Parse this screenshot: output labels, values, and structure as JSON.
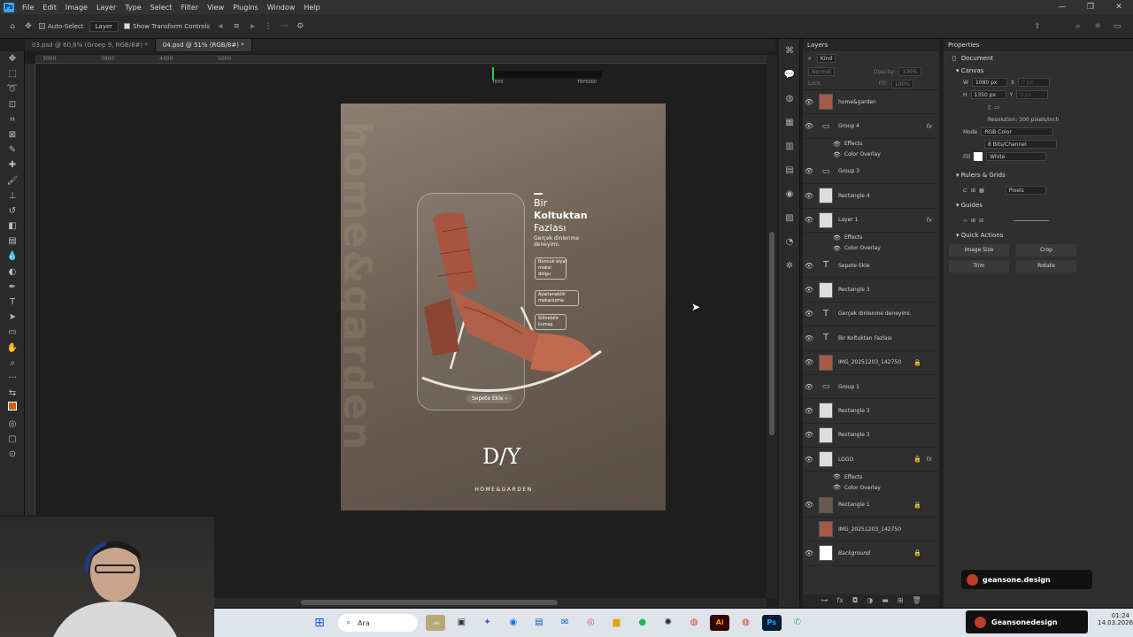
{
  "app": {
    "logo": "Ps"
  },
  "menu": [
    "File",
    "Edit",
    "Image",
    "Layer",
    "Type",
    "Select",
    "Filter",
    "View",
    "Plugins",
    "Window",
    "Help"
  ],
  "options": {
    "auto_select": "Auto-Select",
    "layer_select": "Layer",
    "transform": "Show Transform Controls"
  },
  "tabs": [
    {
      "label": "03.psd @ 60,6% (Groep 9, RGB/8#) *"
    },
    {
      "label": "04.psd @ 51% (RGB/8#) *"
    }
  ],
  "ruler_labels": [
    "3000",
    "3800",
    "4400",
    "5000"
  ],
  "info": {
    "left": "TRY0",
    "right": "TRY5000"
  },
  "poster": {
    "watermark": "home&garden",
    "title_line1": "Bir",
    "title_line2": "Koltuktan",
    "title_line3": "Fazlası",
    "subtitle1": "Gerçek dinlenme",
    "subtitle2": "deneyimi.",
    "feature1": "Boncuk elyaf\nmaksi\ndolgu",
    "feature2": "Ayarlanabilir\nmekanizma",
    "feature3": "Silinebilir\nkumaş",
    "cta": "Sepete Ekle",
    "brand_mark": "D/Y",
    "brand_text": "HOME&GARDEN"
  },
  "layers": {
    "tab": "Layers",
    "filter": "Kind",
    "blend": "Normal",
    "opacity_label": "Opacity:",
    "opacity": "100%",
    "lock_label": "Lock:",
    "fill_label": "Fill:",
    "fill": "100%",
    "rows": [
      {
        "name": "home&garden",
        "type": "img",
        "fx": ""
      },
      {
        "name": "Group 4",
        "type": "folder",
        "fx": "fx"
      },
      {
        "name": "Effects",
        "type": "sub"
      },
      {
        "name": "Color Overlay",
        "type": "sub"
      },
      {
        "name": "Group 3",
        "type": "folder",
        "fx": ""
      },
      {
        "name": "Rectangle 4",
        "type": "plain",
        "fx": ""
      },
      {
        "name": "Layer 1",
        "type": "plain",
        "fx": "fx"
      },
      {
        "name": "Effects",
        "type": "sub"
      },
      {
        "name": "Color Overlay",
        "type": "sub"
      },
      {
        "name": "Sepete Ekle",
        "type": "text",
        "fx": ""
      },
      {
        "name": "Rectangle 3",
        "type": "plain",
        "fx": ""
      },
      {
        "name": "Gerçek dinlenme deneyimi.",
        "type": "text",
        "fx": ""
      },
      {
        "name": "Bir Koltuktan Fazlası",
        "type": "text",
        "fx": ""
      },
      {
        "name": "IMG_20251203_142750",
        "type": "img",
        "fx": "",
        "lock": "🔒"
      },
      {
        "name": "Group 1",
        "type": "folder",
        "fx": ""
      },
      {
        "name": "Rectangle 3",
        "type": "plain",
        "fx": ""
      },
      {
        "name": "Rectangle 3",
        "type": "plain",
        "fx": ""
      },
      {
        "name": "LOGO",
        "type": "plain",
        "fx": "fx",
        "lock": "🔒"
      },
      {
        "name": "Effects",
        "type": "sub"
      },
      {
        "name": "Color Overlay",
        "type": "sub"
      },
      {
        "name": "Rectangle 1",
        "type": "dark",
        "fx": "",
        "lock": "🔒"
      },
      {
        "name": "IMG_20251203_142750",
        "type": "img",
        "fx": ""
      },
      {
        "name": "Background",
        "type": "white",
        "fx": "",
        "lock": "🔒"
      }
    ]
  },
  "properties": {
    "tab": "Properties",
    "document": "Document",
    "canvas": "Canvas",
    "w_label": "W",
    "w": "1080 px",
    "h_label": "H",
    "h": "1350 px",
    "x_label": "X",
    "y_label": "Y",
    "x": "0 px",
    "y": "0 px",
    "resolution": "Resolution: 300 pixels/inch",
    "mode_label": "Mode",
    "mode": "RGB Color",
    "bits": "8 Bits/Channel",
    "fill_label": "Fill",
    "fill": "White",
    "rulers": "Rulers & Grids",
    "units": "Pixels",
    "guides": "Guides",
    "quick": "Quick Actions",
    "btn_image_size": "Image Size",
    "btn_crop": "Crop",
    "btn_trim": "Trim",
    "btn_rotate": "Rotate"
  },
  "toast": "geansone.design",
  "taskbar": {
    "search": "Ara",
    "notice": "Geansonedesign",
    "time": "01:24",
    "date": "14.03.2026"
  }
}
